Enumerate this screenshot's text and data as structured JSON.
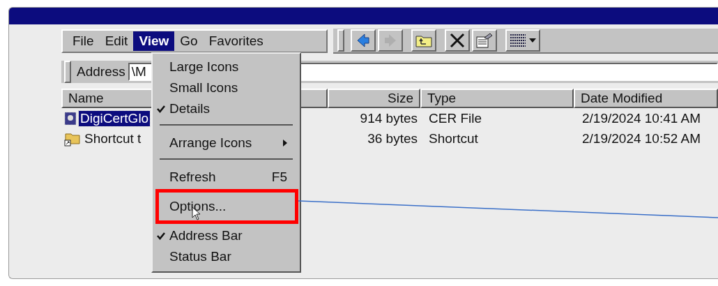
{
  "menu_bar": [
    {
      "label": "File",
      "selected": false
    },
    {
      "label": "Edit",
      "selected": false
    },
    {
      "label": "View",
      "selected": true
    },
    {
      "label": "Go",
      "selected": false
    },
    {
      "label": "Favorites",
      "selected": false
    }
  ],
  "toolbar": [
    {
      "kind": "back",
      "disabled": false
    },
    {
      "kind": "forward",
      "disabled": true
    },
    {
      "kind": "up",
      "disabled": false
    },
    {
      "kind": "delete",
      "disabled": false
    },
    {
      "kind": "properties",
      "disabled": false
    },
    {
      "kind": "views",
      "disabled": false
    }
  ],
  "address_bar": {
    "label": "Address",
    "value": "\\M"
  },
  "file_list": {
    "columns": [
      {
        "label": "Name"
      },
      {
        "label": "Size"
      },
      {
        "label": "Type"
      },
      {
        "label": "Date Modified"
      }
    ],
    "rows": [
      {
        "kind": "certificate",
        "name": "DigiCertGlo",
        "size": "914 bytes",
        "type": "CER File",
        "date_modified": "2/19/2024 10:41 AM",
        "selected": true
      },
      {
        "kind": "shortcut",
        "name": "Shortcut t",
        "size": "36 bytes",
        "type": "Shortcut",
        "date_modified": "2/19/2024 10:52 AM",
        "selected": false
      }
    ]
  },
  "view_menu": {
    "items": [
      {
        "kind": "item",
        "label": "Large Icons",
        "checked": false,
        "annotated": false
      },
      {
        "kind": "item",
        "label": "Small Icons",
        "checked": false,
        "annotated": false
      },
      {
        "kind": "item",
        "label": "Details",
        "checked": true,
        "annotated": false
      },
      {
        "kind": "separator"
      },
      {
        "kind": "submenu",
        "label": "Arrange Icons"
      },
      {
        "kind": "separator"
      },
      {
        "kind": "item",
        "label": "Refresh",
        "shortcut": "F5",
        "checked": false,
        "annotated": false
      },
      {
        "kind": "item",
        "label": "Options...",
        "checked": false,
        "annotated": true
      },
      {
        "kind": "item",
        "label": "Address Bar",
        "checked": true,
        "annotated": false
      },
      {
        "kind": "item",
        "label": "Status Bar",
        "checked": false,
        "annotated": false
      }
    ]
  }
}
